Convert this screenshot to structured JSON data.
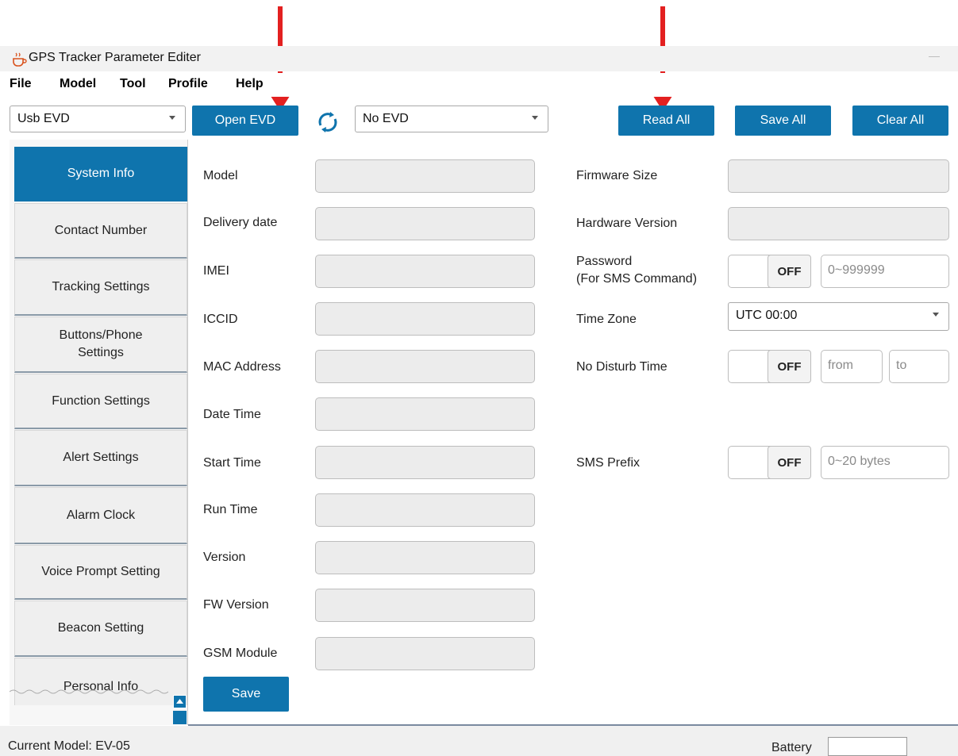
{
  "window": {
    "title": "GPS Tracker Parameter Editer"
  },
  "menu": [
    "File",
    "Model",
    "Tool",
    "Profile",
    "Help"
  ],
  "toolbar": {
    "connection_select": "Usb EVD",
    "open_button": "Open EVD",
    "device_select": "No EVD",
    "read_all": "Read All",
    "save_all": "Save All",
    "clear_all": "Clear All"
  },
  "sidebar": {
    "items": [
      "System Info",
      "Contact Number",
      "Tracking Settings",
      "Buttons/Phone Settings",
      "Function Settings",
      "Alert Settings",
      "Alarm Clock",
      "Voice Prompt Setting",
      "Beacon Setting",
      "Personal Info"
    ],
    "active": "System Info"
  },
  "left_fields": [
    "Model",
    "Delivery date",
    "IMEI",
    "ICCID",
    "MAC Address",
    "Date Time",
    "Start Time",
    "Run Time",
    "Version",
    "FW Version",
    "GSM Module"
  ],
  "save_button": "Save",
  "right": {
    "firmware_size": "Firmware Size",
    "hardware_version": "Hardware Version",
    "password_label": "Password",
    "password_sub": "(For SMS Command)",
    "password_toggle": "OFF",
    "password_placeholder": "0~999999",
    "time_zone_label": "Time Zone",
    "time_zone_value": "UTC 00:00",
    "no_disturb_label": "No Disturb Time",
    "no_disturb_toggle": "OFF",
    "from_placeholder": "from",
    "to_placeholder": "to",
    "sms_prefix_label": "SMS Prefix",
    "sms_prefix_toggle": "OFF",
    "sms_prefix_placeholder": "0~20 bytes"
  },
  "status": {
    "current_model": "Current Model: EV-05",
    "battery_label": "Battery"
  },
  "colors": {
    "accent": "#0f74ad",
    "arrow": "#e32020"
  }
}
